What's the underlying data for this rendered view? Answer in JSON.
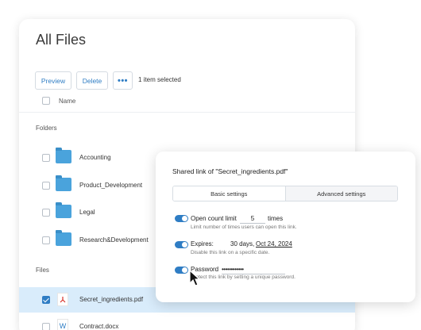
{
  "files_panel": {
    "title": "All Files",
    "toolbar": {
      "preview_label": "Preview",
      "delete_label": "Delete",
      "more_label": "•••",
      "selection_status": "1 item selected"
    },
    "header": {
      "name_label": "Name"
    },
    "folders_label": "Folders",
    "folders": [
      {
        "name": "Accounting"
      },
      {
        "name": "Product_Development"
      },
      {
        "name": "Legal"
      },
      {
        "name": "Research&Development"
      }
    ],
    "files_label": "Files",
    "files": [
      {
        "name": "Secret_ingredients.pdf",
        "icon": "pdf-icon",
        "selected": true
      },
      {
        "name": "Contract.docx",
        "icon": "word-doc-icon",
        "selected": false
      }
    ]
  },
  "share_dialog": {
    "title": "Shared link of \"Secret_ingredients.pdf\"",
    "tabs": [
      {
        "label": "Basic settings",
        "active": true
      },
      {
        "label": "Advanced settings",
        "active": false
      }
    ],
    "settings": {
      "open_count": {
        "label": "Open count limit",
        "value": "5",
        "unit": "times",
        "help": "Limit number of times users can open this link.",
        "enabled": true
      },
      "expires": {
        "label": "Expires:",
        "days": "30 days,",
        "date": "Oct 24, 2024",
        "help": "Disable this link on a specific date.",
        "enabled": true
      },
      "password": {
        "label": "Password",
        "value": "••••••••••••",
        "help": "Protect this link by setting a unique password.",
        "enabled": true
      }
    }
  },
  "colors": {
    "accent": "#2f7dc4",
    "folder": "#4aa3dc",
    "selected_row": "#d9ecfb",
    "pdf_red": "#d9342b"
  }
}
